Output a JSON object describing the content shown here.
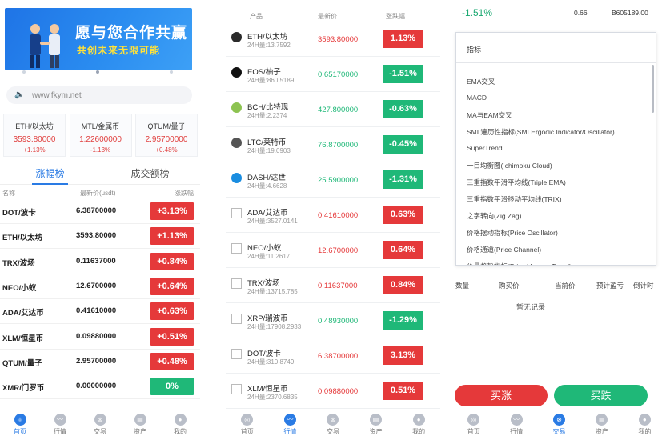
{
  "panel1": {
    "banner": {
      "title": "愿与您合作共赢",
      "subtitle": "共创未来无限可能"
    },
    "notice": "www.fkym.net",
    "tickers": [
      {
        "name": "ETH/以太坊",
        "price": "3593.80000",
        "change": "+1.13%"
      },
      {
        "name": "MTL/金属币",
        "price": "1.22600000",
        "change": "-1.13%"
      },
      {
        "name": "QTUM/量子",
        "price": "2.95700000",
        "change": "+0.48%"
      }
    ],
    "tabs": [
      "涨幅榜",
      "成交额榜"
    ],
    "headers": [
      "名称",
      "最新价(usdt)",
      "涨跌幅"
    ],
    "rows": [
      {
        "name": "DOT/波卡",
        "price": "6.38700000",
        "change": "+3.13%",
        "color": "#e5393a"
      },
      {
        "name": "ETH/以太坊",
        "price": "3593.80000",
        "change": "+1.13%",
        "color": "#e5393a"
      },
      {
        "name": "TRX/波场",
        "price": "0.11637000",
        "change": "+0.84%",
        "color": "#e5393a"
      },
      {
        "name": "NEO/小蚁",
        "price": "12.6700000",
        "change": "+0.64%",
        "color": "#e5393a"
      },
      {
        "name": "ADA/艾达币",
        "price": "0.41610000",
        "change": "+0.63%",
        "color": "#e5393a"
      },
      {
        "name": "XLM/恒星币",
        "price": "0.09880000",
        "change": "+0.51%",
        "color": "#e5393a"
      },
      {
        "name": "QTUM/量子",
        "price": "2.95700000",
        "change": "+0.48%",
        "color": "#e5393a"
      },
      {
        "name": "XMR/门罗币",
        "price": "0.00000000",
        "change": "0%",
        "color": "#1fb878"
      }
    ]
  },
  "nav": [
    "首页",
    "行情",
    "交易",
    "资产",
    "我的"
  ],
  "panel2": {
    "headers": [
      "产品",
      "最新价",
      "涨跌幅"
    ],
    "rows": [
      {
        "name": "ETH/以太坊",
        "vol": "24H量:13.7592",
        "price": "3593.80000",
        "change": "1.13%",
        "up": true,
        "icon": "#2b2b2b",
        "img": false
      },
      {
        "name": "EOS/柚子",
        "vol": "24H量:860.5189",
        "price": "0.65170000",
        "change": "-1.51%",
        "up": false,
        "icon": "#111111",
        "img": false
      },
      {
        "name": "BCH/比特现",
        "vol": "24H量:2.2374",
        "price": "427.800000",
        "change": "-0.63%",
        "up": false,
        "icon": "#8dc351",
        "img": false
      },
      {
        "name": "LTC/莱特币",
        "vol": "24H量:19.0903",
        "price": "76.8700000",
        "change": "-0.45%",
        "up": false,
        "icon": "#555555",
        "img": false
      },
      {
        "name": "DASH/达世",
        "vol": "24H量:4.6628",
        "price": "25.5900000",
        "change": "-1.31%",
        "up": false,
        "icon": "#1a8de0",
        "img": false
      },
      {
        "name": "ADA/艾达币",
        "vol": "24H量:3527.0141",
        "price": "0.41610000",
        "change": "0.63%",
        "up": true,
        "icon": "#ffffff",
        "img": true
      },
      {
        "name": "NEO/小蚁",
        "vol": "24H量:11.2617",
        "price": "12.6700000",
        "change": "0.64%",
        "up": true,
        "icon": "#ffffff",
        "img": true
      },
      {
        "name": "TRX/波场",
        "vol": "24H量:13715.785",
        "price": "0.11637000",
        "change": "0.84%",
        "up": true,
        "icon": "#ffffff",
        "img": true
      },
      {
        "name": "XRP/瑞波币",
        "vol": "24H量:17908.2933",
        "price": "0.48930000",
        "change": "-1.29%",
        "up": false,
        "icon": "#ffffff",
        "img": true
      },
      {
        "name": "DOT/波卡",
        "vol": "24H量:310.8749",
        "price": "6.38700000",
        "change": "3.13%",
        "up": true,
        "icon": "#ffffff",
        "img": true
      },
      {
        "name": "XLM/恒星币",
        "vol": "24H量:2370.6835",
        "price": "0.09880000",
        "change": "0.51%",
        "up": true,
        "icon": "#ffffff",
        "img": true
      }
    ]
  },
  "panel3": {
    "change": "-1.51%",
    "stat1_value": "0.66",
    "stat2_value": "B605189.00",
    "dropdown_title": "指标",
    "options": [
      "EMA交叉",
      "MACD",
      "MA与EAM交叉",
      "SMI 遍历性指标(SMI Ergodic Indicator/Oscillator)",
      "SuperTrend",
      "一目均衡图(Ichimoku Cloud)",
      "三重指数平滑平均线(Triple EMA)",
      "三重指数平滑移动平均线(TRIX)",
      "之字转向(Zig Zag)",
      "价格摆动指标(Price Oscillator)",
      "价格通道(Price Channel)",
      "价量趋势指标(Price Volume Trend)"
    ],
    "table_headers": [
      "数量",
      "购买价",
      "当前价",
      "预计盈亏",
      "倒计时"
    ],
    "empty_text": "暂无记录",
    "buy_up": "买涨",
    "buy_down": "买跌"
  },
  "colors": {
    "accent": "#2a7be4",
    "up": "#e5393a",
    "down": "#1fb878"
  }
}
